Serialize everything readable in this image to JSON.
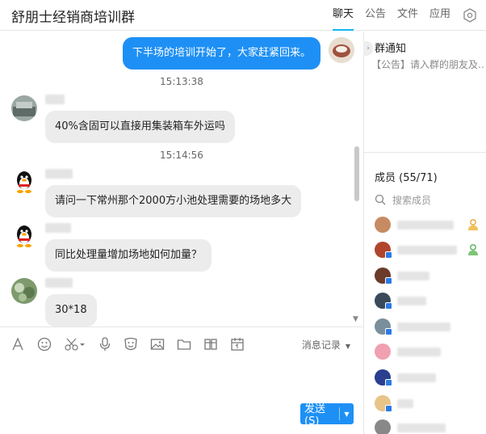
{
  "header": {
    "title": "舒朋士经销商培训群",
    "tabs": [
      {
        "label": "聊天",
        "active": true
      },
      {
        "label": "公告",
        "active": false
      },
      {
        "label": "文件",
        "active": false
      },
      {
        "label": "应用",
        "active": false
      }
    ],
    "settings_icon": "hexagon-settings-icon"
  },
  "chat": {
    "self_message": "下半场的培训开始了，大家赶紧回来。",
    "timestamps": [
      "15:13:38",
      "15:14:56"
    ],
    "messages": [
      {
        "text": "40%含固可以直接用集装箱车外运吗"
      },
      {
        "text": "请问一下常州那个2000方小池处理需要的场地多大"
      },
      {
        "text": "同比处理量增加场地如何加量？"
      },
      {
        "text": "30*18"
      }
    ]
  },
  "toolbar": {
    "icons": [
      "font-icon",
      "emoji-icon",
      "scissors-icon",
      "microphone-icon",
      "face-icon",
      "image-icon",
      "folder-icon",
      "red-packet-icon",
      "calendar-icon"
    ],
    "history_label": "消息记录"
  },
  "composer": {
    "send_label": "发送(S)"
  },
  "sidebar": {
    "notice_title": "群通知",
    "notice_text": "【公告】请入群的朋友及…",
    "members_title": "成员 (55/71)",
    "search_placeholder": "搜索成员"
  },
  "colors": {
    "accent": "#1e90f5",
    "tab_underline": "#12b7f5",
    "bubble_other": "#ececec"
  }
}
